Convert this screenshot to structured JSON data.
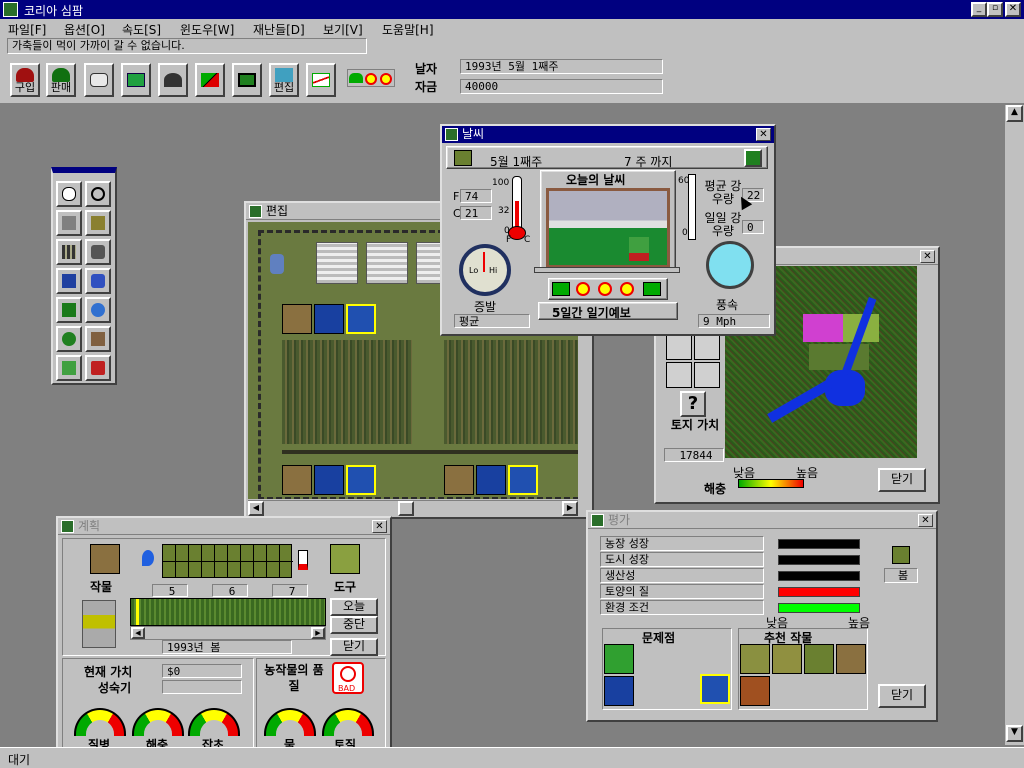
{
  "app": {
    "title": "코리아 심팜"
  },
  "menu": [
    "파일[F]",
    "옵션[O]",
    "속도[S]",
    "윈도우[W]",
    "재난들[D]",
    "보기[V]",
    "도움말[H]"
  ],
  "message": "가축들이 먹이 가까이 갈 수 없습니다.",
  "toolbar": {
    "buy_label": "구입",
    "sell_label": "판매",
    "edit_label": "편집"
  },
  "info": {
    "date_label": "날자",
    "date_value": "1993년   5월  1째주",
    "funds_label": "자금",
    "funds_value": "40000"
  },
  "edit_window": {
    "title": "편집"
  },
  "weather": {
    "title": "날씨",
    "week_label": "5월  1째주",
    "until_label": "7 주  까지",
    "today_label": "오늘의  날씨",
    "temp_f_label": "F",
    "temp_f": "74",
    "temp_c_label": "C",
    "temp_c": "21",
    "scale_top": "100",
    "scale_mid": "32",
    "scale_bot": "0",
    "scale_unit_f": "F",
    "scale_unit_c": "C",
    "rain_top": "60",
    "rain_bot": "0",
    "avg_rain_label": "평균 강우량",
    "avg_rain": "22",
    "daily_rain_label": "일일 강우량",
    "daily_rain": "0",
    "evap_label": "증발",
    "evap_value": "평균",
    "gauge_lo": "Lo",
    "gauge_hi": "Hi",
    "forecast_label": "5일간  일기예보",
    "wind_label": "풍속",
    "wind_value": "9  Mph"
  },
  "map_window": {
    "land_value_label": "토지 가치",
    "land_value": "17844",
    "low": "낮음",
    "high": "높음",
    "pest_label": "해충",
    "close_label": "닫기",
    "help_icon_text": "?"
  },
  "plan": {
    "title": "계획",
    "crop_label": "작물",
    "tool_label": "도구",
    "weeks": [
      "5",
      "6",
      "7"
    ],
    "season": "1993년    봄",
    "today_btn": "오늘",
    "stop_btn": "중단",
    "close_btn": "닫기",
    "value_label": "현재 가치",
    "value": "$0",
    "growth_label": "성숙기",
    "quality_label": "농작물의 품질",
    "bad_label": "BAD",
    "gauges": [
      "질병",
      "해충",
      "잡초",
      "물",
      "토질"
    ]
  },
  "eval": {
    "title": "평가",
    "rows": [
      {
        "label": "농장 성장",
        "color": "#000000"
      },
      {
        "label": "도시 성장",
        "color": "#000000"
      },
      {
        "label": "생산성",
        "color": "#000000"
      },
      {
        "label": "토양의 질",
        "color": "#ff0000"
      },
      {
        "label": "환경 조건",
        "color": "#00ff00"
      }
    ],
    "season": "봄",
    "low": "낮음",
    "high": "높음",
    "problems_label": "문제점",
    "recommend_label": "추천 작물",
    "close_label": "닫기"
  },
  "palette": {
    "icons": [
      "info-icon",
      "magnifier-icon",
      "fence-icon",
      "hay-icon",
      "road-icon",
      "bridge-icon",
      "pipe-icon",
      "tractor-icon",
      "tree-icon",
      "pond-icon",
      "bush-icon",
      "barn-icon",
      "plant-icon",
      "barrel-icon"
    ]
  },
  "status": "대기"
}
